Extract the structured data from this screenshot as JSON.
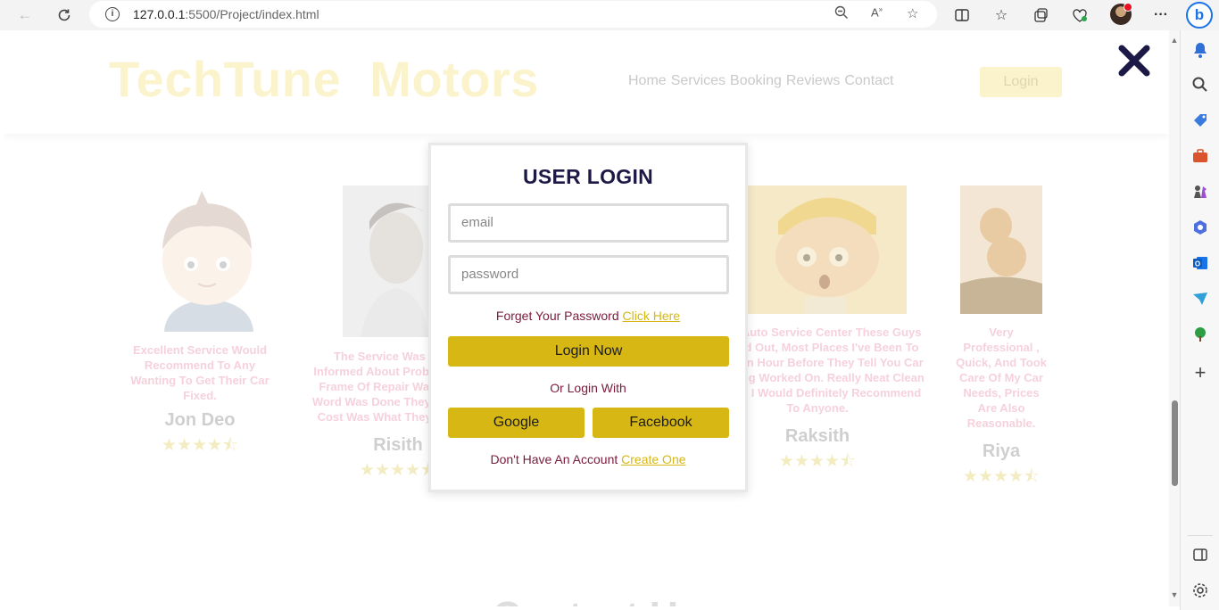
{
  "browser": {
    "url_host": "127.0.0.1",
    "url_rest": ":5500/Project/index.html"
  },
  "site": {
    "brand": "TechTune  Motors",
    "nav": [
      "Home",
      "Services",
      "Booking",
      "Reviews",
      "Contact"
    ],
    "login_button": "Login",
    "bottom_heading": "Contact Us"
  },
  "reviews": [
    {
      "text": "Excellent Service Would Recommend To Any Wanting To Get Their Car Fixed.",
      "name": "Jon Deo",
      "rating": 4.5
    },
    {
      "text": "The Service Was Great, Informed About Problem, Time Frame Of Repair Was 2 Their Word Was Done They Said And Cost Was What They Quoted.",
      "name": "Risith",
      "rating": 4.5
    },
    {
      "text": "Best Auto Service Center These Guys In And Out, Most Places I've Been To Wait An Hour Before They Tell You Car Is Being Worked On. Really Neat Clean Space I Would Definitely Recommend To Anyone.",
      "name": "Raksith",
      "rating": 4.5
    },
    {
      "text": "Very Professional , Quick, And Took Care Of My Car Needs, Prices Are Also Reasonable.",
      "name": "Riya",
      "rating": 4.5
    }
  ],
  "stars_display": "★★★★⯪",
  "modal": {
    "title": "USER LOGIN",
    "email_placeholder": "email",
    "password_placeholder": "password",
    "forgot_text": "Forget Your Password ",
    "forgot_link": "Click Here",
    "login_now": "Login Now",
    "or_login_with": "Or Login With",
    "google": "Google",
    "facebook": "Facebook",
    "no_account_text": "Don't Have An Account ",
    "create_link": "Create One"
  },
  "colors": {
    "accent": "#d6b713",
    "title": "#1d1946",
    "text_maroon": "#7a1a3c"
  }
}
